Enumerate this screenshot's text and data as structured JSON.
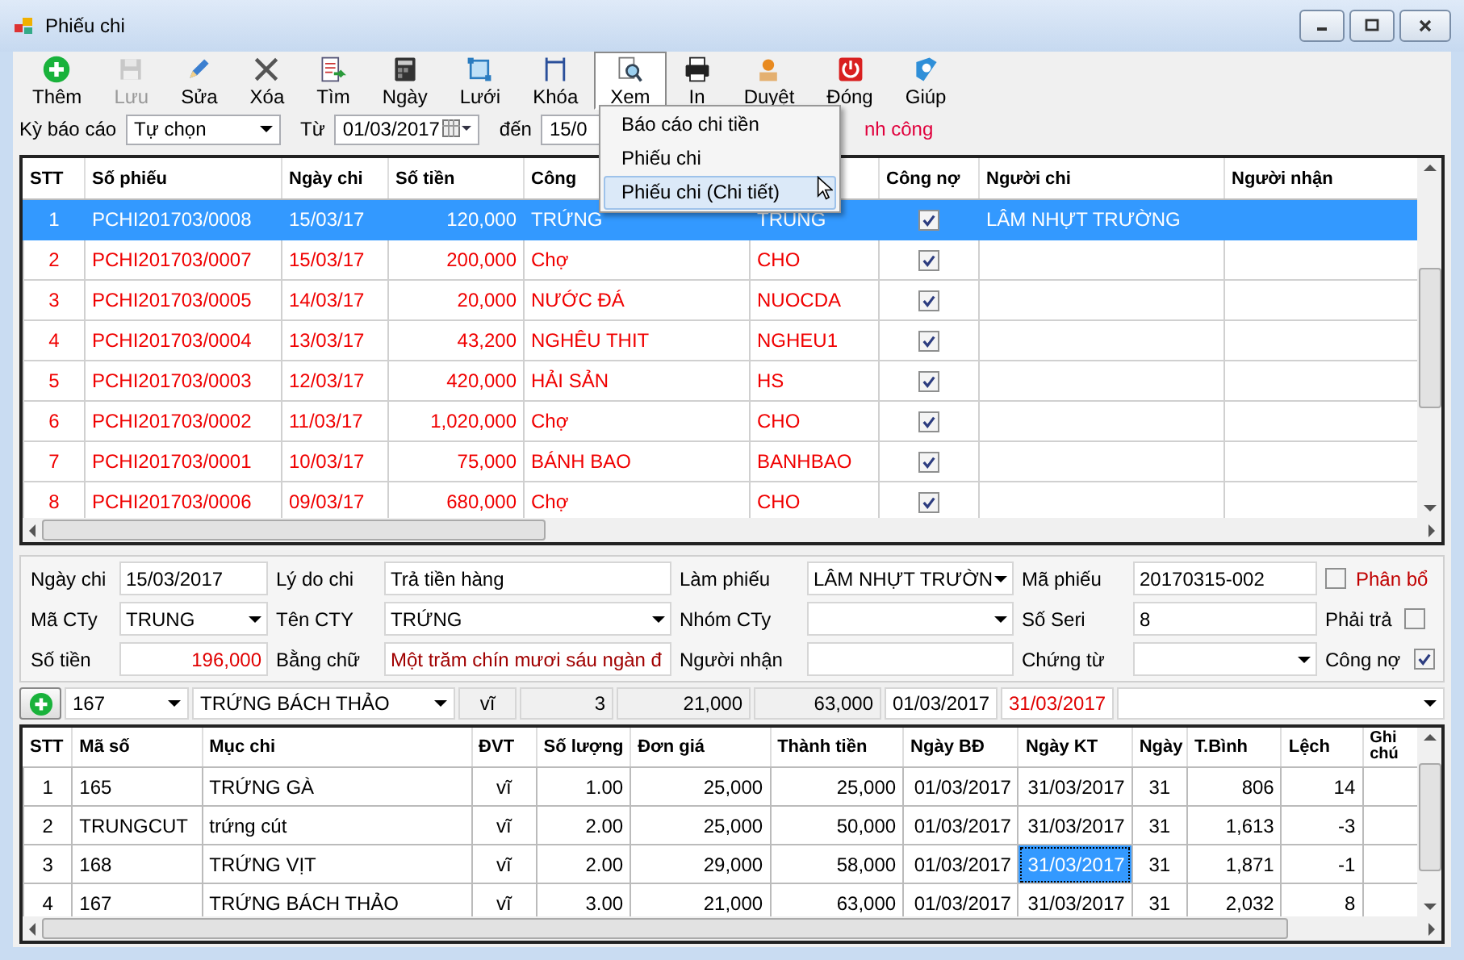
{
  "window": {
    "title": "Phiếu chi"
  },
  "toolbar": [
    {
      "label": "Thêm",
      "selected": false,
      "disabled": false
    },
    {
      "label": "Lưu",
      "selected": false,
      "disabled": true
    },
    {
      "label": "Sửa",
      "selected": false,
      "disabled": false
    },
    {
      "label": "Xóa",
      "selected": false,
      "disabled": false
    },
    {
      "label": "Tìm",
      "selected": false,
      "disabled": false
    },
    {
      "label": "Ngày",
      "selected": false,
      "disabled": false
    },
    {
      "label": "Lưới",
      "selected": false,
      "disabled": false
    },
    {
      "label": "Khóa",
      "selected": false,
      "disabled": false
    },
    {
      "label": "Xem",
      "selected": true,
      "disabled": false
    },
    {
      "label": "In",
      "selected": false,
      "disabled": false
    },
    {
      "label": "Duyệt",
      "selected": false,
      "disabled": false
    },
    {
      "label": "Đóng",
      "selected": false,
      "disabled": false
    },
    {
      "label": "Giúp",
      "selected": false,
      "disabled": false
    }
  ],
  "filter": {
    "period_label": "Kỳ báo cáo",
    "period": "Tự chọn",
    "from_label": "Từ",
    "from": "01/03/2017",
    "to_label": "đến",
    "to": "15/0",
    "status": "nh công"
  },
  "menu": {
    "items": [
      {
        "label": "Báo cáo chi tiền",
        "selected": false
      },
      {
        "label": "Phiếu chi",
        "selected": false
      },
      {
        "label": "Phiếu chi (Chi tiết)",
        "selected": true
      }
    ]
  },
  "table": {
    "headers": {
      "stt": "STT",
      "so_phieu": "Số phiếu",
      "ngay_chi": "Ngày chi",
      "so_tien": "Số tiền",
      "cong_ty": "Công",
      "cong_no": "Công nợ",
      "nguoi_chi": "Người chi",
      "nguoi_nhan": "Người nhận"
    },
    "rows": [
      {
        "stt": "1",
        "so_phieu": "PCHI201703/0008",
        "ngay_chi": "15/03/17",
        "so_tien": "120,000",
        "cong_ty": "TRỨNG",
        "column_5": "TRUNG",
        "cong_no": true,
        "nguoi_chi": "LÂM NHỰT TRƯỜNG",
        "selected": true
      },
      {
        "stt": "2",
        "so_phieu": "PCHI201703/0007",
        "ngay_chi": "15/03/17",
        "so_tien": "200,000",
        "cong_ty": "Chợ",
        "column_5": "CHO",
        "cong_no": true,
        "selected": false
      },
      {
        "stt": "3",
        "so_phieu": "PCHI201703/0005",
        "ngay_chi": "14/03/17",
        "so_tien": "20,000",
        "cong_ty": "NƯỚC ĐÁ",
        "column_5": "NUOCDA",
        "cong_no": true,
        "selected": false
      },
      {
        "stt": "4",
        "so_phieu": "PCHI201703/0004",
        "ngay_chi": "13/03/17",
        "so_tien": "43,200",
        "cong_ty": "NGHÊU THIT",
        "column_5": "NGHEU1",
        "cong_no": true,
        "selected": false
      },
      {
        "stt": "5",
        "so_phieu": "PCHI201703/0003",
        "ngay_chi": "12/03/17",
        "so_tien": "420,000",
        "cong_ty": "HẢI SẢN",
        "column_5": "HS",
        "cong_no": true,
        "selected": false
      },
      {
        "stt": "6",
        "so_phieu": "PCHI201703/0002",
        "ngay_chi": "11/03/17",
        "so_tien": "1,020,000",
        "cong_ty": "Chợ",
        "column_5": "CHO",
        "cong_no": true,
        "selected": false
      },
      {
        "stt": "7",
        "so_phieu": "PCHI201703/0001",
        "ngay_chi": "10/03/17",
        "so_tien": "75,000",
        "cong_ty": "BÁNH BAO",
        "column_5": "BANHBAO",
        "cong_no": true,
        "selected": false
      },
      {
        "stt": "8",
        "so_phieu": "PCHI201703/0006",
        "ngay_chi": "09/03/17",
        "so_tien": "680,000",
        "cong_ty": "Chợ",
        "column_5": "CHO",
        "cong_no": true,
        "selected": false
      }
    ]
  },
  "form": {
    "rows": [
      [
        {
          "label": "Ngày chi",
          "value": "15/03/2017",
          "kind": "text",
          "color": "#000000"
        },
        {
          "label": "Lý do chi",
          "value": "Trả tiền hàng",
          "kind": "text",
          "color": "#000000"
        },
        {
          "label": "Làm phiếu",
          "value": "LÂM NHỰT TRƯỜN",
          "kind": "combo",
          "color": "#000000"
        },
        {
          "label": "Mã phiếu",
          "value": "20170315-002",
          "kind": "text",
          "color": "#000000"
        }
      ],
      [
        {
          "label": "Mã CTy",
          "value": "TRUNG",
          "kind": "combo",
          "color": "#000000"
        },
        {
          "label": "Tên CTY",
          "value": "TRỨNG",
          "kind": "combo",
          "color": "#000000"
        },
        {
          "label": "Nhóm CTy",
          "kind": "combo"
        },
        {
          "label": "Số Seri",
          "value": "8",
          "kind": "text",
          "color": "#000000"
        }
      ],
      [
        {
          "label": "Số tiền",
          "value": "196,000",
          "kind": "number",
          "color": "#e00000"
        },
        {
          "label": "Bằng chữ",
          "value": "Một trăm chín mươi sáu ngàn đ",
          "kind": "text",
          "color": "#a00000"
        },
        {
          "label": "Người nhận",
          "kind": "text"
        },
        {
          "label": "Chứng từ",
          "kind": "combo"
        }
      ]
    ],
    "checks": [
      {
        "label": "Phân bổ",
        "checked": false,
        "kind": "box_first",
        "color": "#c00000"
      },
      {
        "label": "Phải trả",
        "checked": false,
        "kind": "box_last",
        "color": "#000000"
      },
      {
        "label": "Công nợ",
        "checked": true,
        "kind": "box_last",
        "color": "#000000"
      }
    ]
  },
  "entry": {
    "ma_so": "167",
    "muc_chi": "TRỨNG BÁCH THẢO",
    "dvt": "vĩ",
    "so_luong": "3",
    "don_gia": "21,000",
    "thanh_tien": "63,000",
    "ngay_bd": "01/03/2017",
    "ngay_kt": "31/03/2017"
  },
  "detail": {
    "headers": {
      "stt": "STT",
      "ma_so": "Mã số",
      "muc_chi": "Mục chi",
      "dvt": "ĐVT",
      "so_luong": "Số lượng",
      "don_gia": "Đơn giá",
      "thanh_tien": "Thành tiền",
      "ngay_bd": "Ngày BĐ",
      "ngay_kt": "Ngày KT",
      "ngay": "Ngày",
      "t_binh": "T.Bình",
      "lech": "Lệch",
      "ghi_chu": "Ghi chú"
    },
    "rows": [
      {
        "stt": "1",
        "ma_so": "165",
        "muc_chi": "TRỨNG GÀ",
        "dvt": "vĩ",
        "so_luong": "1.00",
        "don_gia": "25,000",
        "thanh_tien": "25,000",
        "ngay_bd": "01/03/2017",
        "ngay_kt": "31/03/2017",
        "ngay": "31",
        "t_binh": "806",
        "lech": "14",
        "ngay_kt_selected": false
      },
      {
        "stt": "2",
        "ma_so": "TRUNGCUT",
        "muc_chi": "trứng cút",
        "dvt": "vĩ",
        "so_luong": "2.00",
        "don_gia": "25,000",
        "thanh_tien": "50,000",
        "ngay_bd": "01/03/2017",
        "ngay_kt": "31/03/2017",
        "ngay": "31",
        "t_binh": "1,613",
        "lech": "-3",
        "ngay_kt_selected": false
      },
      {
        "stt": "3",
        "ma_so": "168",
        "muc_chi": "TRỨNG VỊT",
        "dvt": "vĩ",
        "so_luong": "2.00",
        "don_gia": "29,000",
        "thanh_tien": "58,000",
        "ngay_bd": "01/03/2017",
        "ngay_kt": "31/03/2017",
        "ngay": "31",
        "t_binh": "1,871",
        "lech": "-1",
        "ngay_kt_selected": true
      },
      {
        "stt": "4",
        "ma_so": "167",
        "muc_chi": "TRỨNG BÁCH THẢO",
        "dvt": "vĩ",
        "so_luong": "3.00",
        "don_gia": "21,000",
        "thanh_tien": "63,000",
        "ngay_bd": "01/03/2017",
        "ngay_kt": "31/03/2017",
        "ngay": "31",
        "t_binh": "2,032",
        "lech": "8",
        "ngay_kt_selected": false
      }
    ]
  }
}
